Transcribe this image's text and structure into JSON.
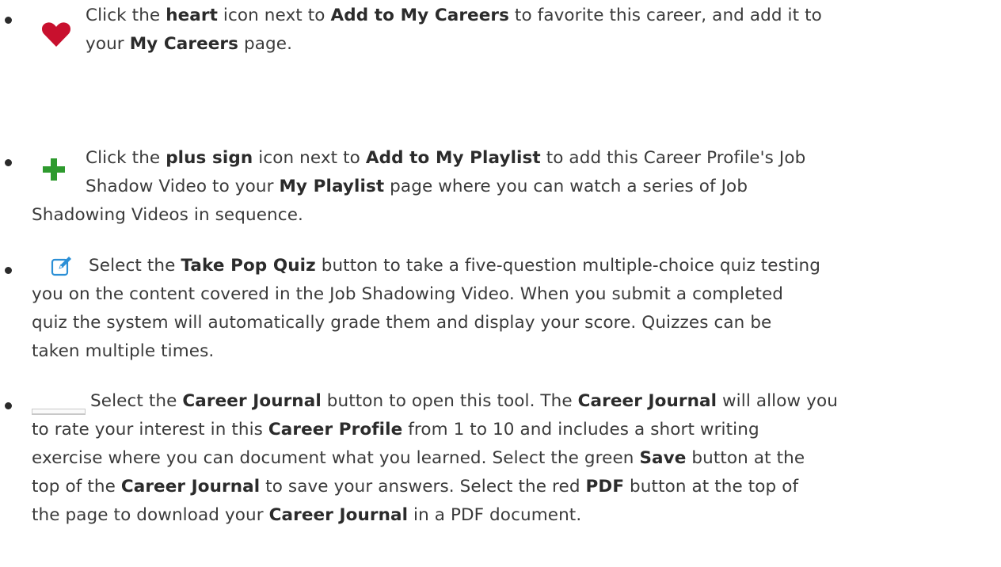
{
  "items": [
    {
      "icon": "heart-icon",
      "icon_color": "#c8102e",
      "lines": [
        [
          "Click the ",
          {
            "b": "heart"
          },
          " icon next to ",
          {
            "b": "Add to My Careers"
          },
          " to favorite this career, and add it to"
        ],
        [
          "your ",
          {
            "b": "My Careers"
          },
          " page."
        ]
      ]
    },
    {
      "icon": "plus-icon",
      "icon_color": "#2e9a2e",
      "lines": [
        [
          "Click the ",
          {
            "b": "plus sign"
          },
          " icon next to ",
          {
            "b": "Add to My Playlist"
          },
          " to add this Career Profile's Job"
        ],
        [
          "Shadow Video to your ",
          {
            "b": "My Playlist"
          },
          " page where you can watch a series of Job"
        ],
        [
          "Shadowing Videos in sequence."
        ]
      ]
    },
    {
      "icon": "edit-icon",
      "icon_color": "#2b8fd6",
      "lines": [
        [
          "Select the ",
          {
            "b": "Take Pop Quiz"
          },
          " button to take a five-question multiple-choice quiz testing"
        ],
        [
          "you on the content covered in the Job Shadowing Video. When you submit a completed"
        ],
        [
          "quiz the system will automatically grade them and display your score. Quizzes can be"
        ],
        [
          "taken multiple times."
        ]
      ]
    },
    {
      "icon": "career-journal-button-icon",
      "icon_color": "#c8c8c8",
      "lines": [
        [
          "Select the ",
          {
            "b": "Career Journal"
          },
          " button to open this tool.  The ",
          {
            "b": "Career Journal"
          },
          " will allow you"
        ],
        [
          "to rate your interest in this ",
          {
            "b": "Career Profile"
          },
          " from 1 to 10 and includes a short writing"
        ],
        [
          "exercise where you can document what you learned. Select the green ",
          {
            "b": "Save"
          },
          " button at the"
        ],
        [
          "top of the ",
          {
            "b": "Career Journal"
          },
          " to save your answers. Select the red ",
          {
            "b": "PDF"
          },
          " button at the top of"
        ],
        [
          "the page to download your ",
          {
            "b": "Career Journal"
          },
          " in a PDF document."
        ]
      ]
    }
  ]
}
